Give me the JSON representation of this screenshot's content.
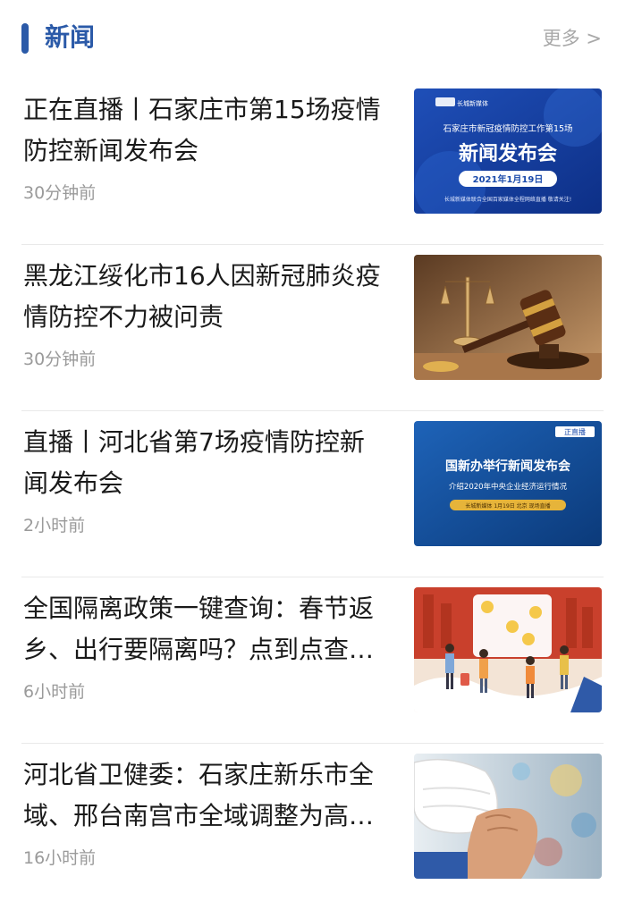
{
  "section": {
    "title": "新闻",
    "more_label": "更多 >"
  },
  "news": [
    {
      "headline": "正在直播丨石家庄市第15场疫情防控新闻发布会",
      "time": "30分钟前",
      "thumb_icon": "press-conference-banner",
      "thumb_texts": {
        "logo": "长城新媒体",
        "line1": "石家庄市新冠疫情防控工作第15场",
        "line2": "新闻发布会",
        "date": "2021年1月19日",
        "foot": "长城新媒体联合全国百家媒体全程网络直播 敬请关注!"
      }
    },
    {
      "headline": "黑龙江绥化市16人因新冠肺炎疫情防控不力被问责",
      "time": "30分钟前",
      "thumb_icon": "gavel-scales-photo"
    },
    {
      "headline": "直播丨河北省第7场疫情防控新闻发布会",
      "time": "2小时前",
      "thumb_icon": "press-conference-banner",
      "thumb_texts": {
        "badge": "正直播",
        "line1": "国新办举行新闻发布会",
        "line2": "介绍2020年中央企业经济运行情况",
        "foot": "长城新媒体 1月19日 北京 现场直播"
      }
    },
    {
      "headline": "全国隔离政策一键查询：春节返乡、出行要隔离吗？点到点查询→",
      "time": "6小时前",
      "thumb_icon": "travelers-illustration"
    },
    {
      "headline": "河北省卫健委：石家庄新乐市全域、邢台南宫市全域调整为高风险地区",
      "time": "16小时前",
      "thumb_icon": "mask-hand-photo"
    }
  ],
  "colors": {
    "accent": "#2b5aa8",
    "time_text": "#9a9a9a",
    "more_text": "#a8a8a8"
  }
}
